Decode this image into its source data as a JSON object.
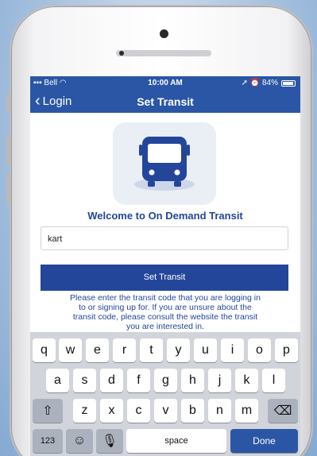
{
  "status_bar": {
    "carrier": "Bell",
    "time": "10:00 AM",
    "battery": "84%"
  },
  "nav": {
    "back_label": "Login",
    "title": "Set Transit"
  },
  "welcome_text": "Welcome to On Demand Transit",
  "transit_input": {
    "value": "kart"
  },
  "set_transit_button": "Set Transit",
  "help_text_lines": [
    "Please enter the transit code that you are logging in",
    "to or signing up for. If you are unsure about the",
    "transit code, please consult the website the transit",
    "you are interested in."
  ],
  "keyboard": {
    "row1": [
      "q",
      "w",
      "e",
      "r",
      "t",
      "y",
      "u",
      "i",
      "o",
      "p"
    ],
    "row2": [
      "a",
      "s",
      "d",
      "f",
      "g",
      "h",
      "j",
      "k",
      "l"
    ],
    "row3": [
      "z",
      "x",
      "c",
      "v",
      "b",
      "n",
      "m"
    ],
    "numbers_key": "123",
    "space_key": "space",
    "done_key": "Done"
  },
  "colors": {
    "brand_blue": "#23469a",
    "bar_blue": "#2a56a5"
  }
}
